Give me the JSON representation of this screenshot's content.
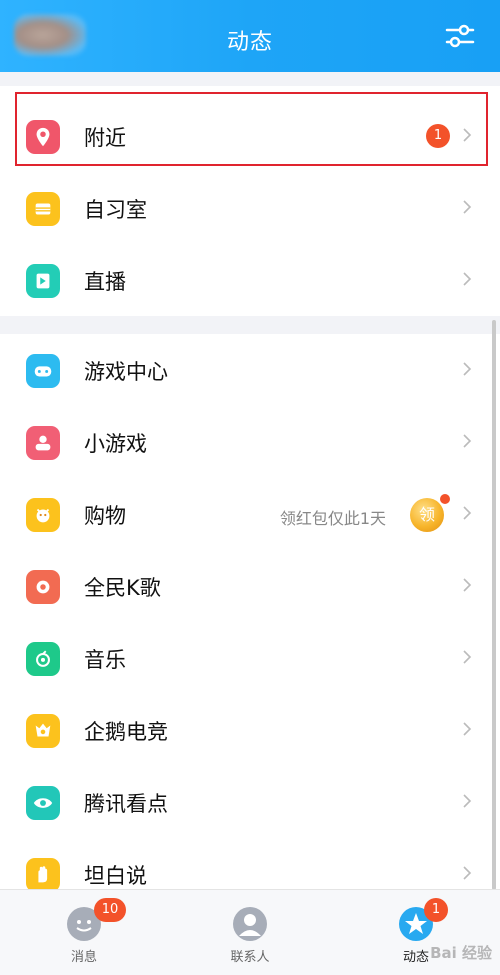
{
  "header": {
    "title": "动态"
  },
  "group1": [
    {
      "label": "附近",
      "icon": "location-pin-icon",
      "color": "#f0566a",
      "badge": "1"
    },
    {
      "label": "自习室",
      "icon": "study-room-icon",
      "color": "#fcc21d"
    },
    {
      "label": "直播",
      "icon": "live-stream-icon",
      "color": "#23cdb6"
    }
  ],
  "group2": [
    {
      "label": "游戏中心",
      "icon": "gamepad-icon",
      "color": "#2dbbf0"
    },
    {
      "label": "小游戏",
      "icon": "mini-game-icon",
      "color": "#f15f75"
    },
    {
      "label": "购物",
      "icon": "shopping-icon",
      "color": "#fcc21d",
      "promo": "领红包仅此1天",
      "coin": "领"
    },
    {
      "label": "全民K歌",
      "icon": "karaoke-icon",
      "color": "#f26b52"
    },
    {
      "label": "音乐",
      "icon": "music-icon",
      "color": "#1ec98a"
    },
    {
      "label": "企鹅电竞",
      "icon": "esports-icon",
      "color": "#fcc21d"
    },
    {
      "label": "腾讯看点",
      "icon": "eye-icon",
      "color": "#22c7b8"
    },
    {
      "label": "坦白说",
      "icon": "hand-icon",
      "color": "#fcc21d"
    }
  ],
  "tabs": [
    {
      "label": "消息",
      "badge": "10"
    },
    {
      "label": "联系人"
    },
    {
      "label": "动态",
      "badge": "1"
    }
  ],
  "watermark": "Bai 经验"
}
